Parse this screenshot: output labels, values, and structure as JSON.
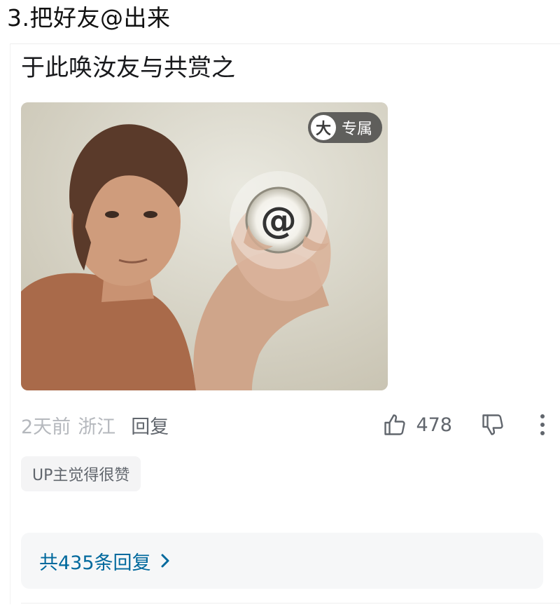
{
  "heading": "3.把好友@出来",
  "comment": {
    "text": "于此唤汝友与共赏之",
    "image": {
      "badge_icon_char": "大",
      "badge_label": "专属",
      "symbol": "@"
    },
    "meta": {
      "time": "2天前",
      "location": "浙江",
      "reply_label": "回复"
    },
    "likes": "478",
    "up_tag": "UP主觉得很赞",
    "replies_link": "共435条回复"
  },
  "icons": {
    "like": "thumb-up-icon",
    "dislike": "thumb-down-icon",
    "more": "more-vertical-icon",
    "chevron": "chevron-right-icon"
  },
  "colors": {
    "link": "#00699d",
    "muted": "#b5b8bd",
    "secondary": "#61666d"
  }
}
